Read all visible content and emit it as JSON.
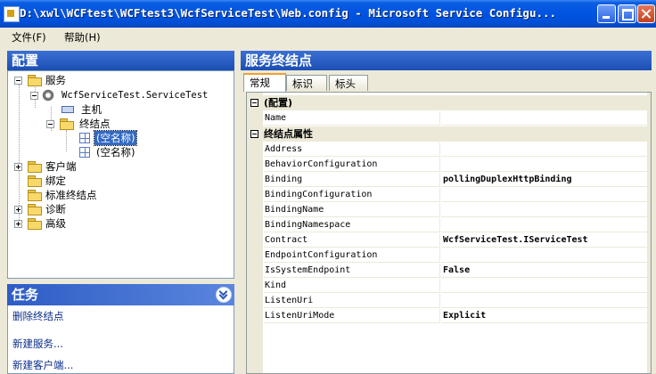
{
  "window": {
    "title": "D:\\xwl\\WCFtest\\WCFtest3\\WcfServiceTest\\Web.config - Microsoft Service Configu..."
  },
  "menu": {
    "file": "文件(F)",
    "help": "帮助(H)"
  },
  "config_panel": {
    "header": "配置",
    "tree": {
      "services": "服务",
      "service_name": "WcfServiceTest.ServiceTest",
      "host": "主机",
      "endpoints": "终结点",
      "endpoint1": "(空名称)",
      "endpoint2": "(空名称)",
      "client": "客户端",
      "bindings": "绑定",
      "standard_endpoints": "标准终结点",
      "diagnostics": "诊断",
      "advanced": "高级"
    }
  },
  "tasks_panel": {
    "header": "任务",
    "delete_endpoint": "删除终结点",
    "new_service": "新建服务...",
    "new_client": "新建客户端..."
  },
  "detail": {
    "header": "服务终结点",
    "tabs": {
      "general": "常规",
      "identity": "标识",
      "headers": "标头"
    },
    "cat_config": "(配置)",
    "cat_endpoint": "终结点属性",
    "props": {
      "name": {
        "label": "Name",
        "value": ""
      },
      "address": {
        "label": "Address",
        "value": ""
      },
      "behavior_configuration": {
        "label": "BehaviorConfiguration",
        "value": ""
      },
      "binding": {
        "label": "Binding",
        "value": "pollingDuplexHttpBinding"
      },
      "binding_configuration": {
        "label": "BindingConfiguration",
        "value": ""
      },
      "binding_name": {
        "label": "BindingName",
        "value": ""
      },
      "binding_namespace": {
        "label": "BindingNamespace",
        "value": ""
      },
      "contract": {
        "label": "Contract",
        "value": "WcfServiceTest.IServiceTest"
      },
      "endpoint_configuration": {
        "label": "EndpointConfiguration",
        "value": ""
      },
      "is_system_endpoint": {
        "label": "IsSystemEndpoint",
        "value": "False"
      },
      "kind": {
        "label": "Kind",
        "value": ""
      },
      "listen_uri": {
        "label": "ListenUri",
        "value": ""
      },
      "listen_uri_mode": {
        "label": "ListenUriMode",
        "value": "Explicit"
      }
    }
  }
}
